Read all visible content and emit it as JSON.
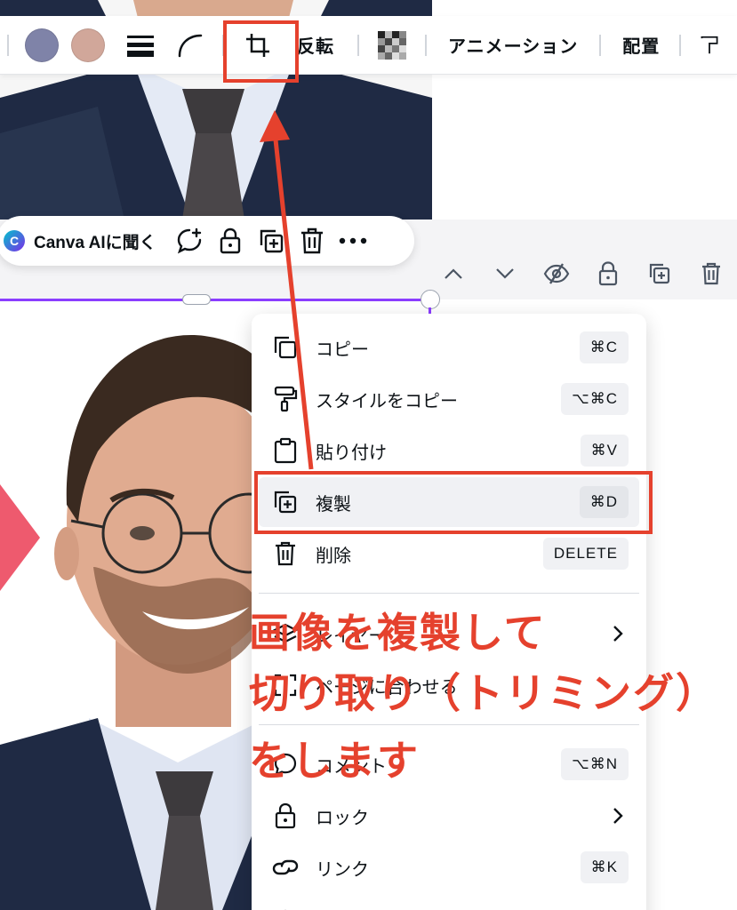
{
  "toolbar": {
    "swatch_colors": [
      "#7f83a8",
      "#d1a79a"
    ],
    "flip_label": "反転",
    "animation_label": "アニメーション",
    "position_label": "配置"
  },
  "ai_pill": {
    "label": "Canva AIに聞く"
  },
  "context_menu": {
    "items": [
      {
        "label": "コピー",
        "shortcut": "⌘C",
        "icon": "copy-icon"
      },
      {
        "label": "スタイルをコピー",
        "shortcut": "⌥⌘C",
        "icon": "paint-roller-icon"
      },
      {
        "label": "貼り付け",
        "shortcut": "⌘V",
        "icon": "clipboard-icon"
      },
      {
        "label": "複製",
        "shortcut": "⌘D",
        "icon": "duplicate-icon"
      },
      {
        "label": "削除",
        "shortcut": "DELETE",
        "icon": "trash-icon"
      },
      {
        "label": "レイヤー",
        "icon": "layers-icon"
      },
      {
        "label": "ページに合わせる",
        "icon": "fit-page-icon"
      },
      {
        "label": "コメント",
        "shortcut": "⌥⌘N",
        "icon": "comment-icon"
      },
      {
        "label": "ロック",
        "icon": "lock-icon"
      },
      {
        "label": "リンク",
        "shortcut": "⌘K",
        "icon": "link-icon"
      }
    ]
  },
  "annotation": {
    "line1": "画像を複製して",
    "line2": "切り取り（トリミング）",
    "line3": "をします",
    "color": "#e5412d"
  },
  "accent_color": "#8b3dff"
}
